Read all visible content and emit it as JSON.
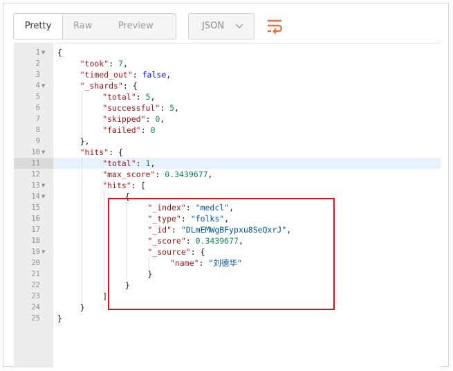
{
  "toolbar": {
    "tabs": [
      {
        "label": "Pretty",
        "active": true
      },
      {
        "label": "Raw",
        "active": false
      },
      {
        "label": "Preview",
        "active": false
      }
    ],
    "format": {
      "label": "JSON",
      "icon": "chevron-down-icon"
    },
    "wrap_icon": "wrap-lines-icon",
    "accent_color": "#f26b3a"
  },
  "editor": {
    "active_line": 11,
    "lines": [
      {
        "num": "1",
        "fold": true,
        "indent": 0,
        "tokens": [
          {
            "t": "p",
            "v": "{"
          }
        ]
      },
      {
        "num": "2",
        "fold": false,
        "indent": 1,
        "tokens": [
          {
            "t": "k",
            "v": "\"took\""
          },
          {
            "t": "p",
            "v": ": "
          },
          {
            "t": "n",
            "v": "7"
          },
          {
            "t": "p",
            "v": ","
          }
        ]
      },
      {
        "num": "3",
        "fold": false,
        "indent": 1,
        "tokens": [
          {
            "t": "k",
            "v": "\"timed_out\""
          },
          {
            "t": "p",
            "v": ": "
          },
          {
            "t": "b",
            "v": "false"
          },
          {
            "t": "p",
            "v": ","
          }
        ]
      },
      {
        "num": "4",
        "fold": true,
        "indent": 1,
        "tokens": [
          {
            "t": "k",
            "v": "\"_shards\""
          },
          {
            "t": "p",
            "v": ": {"
          }
        ]
      },
      {
        "num": "5",
        "fold": false,
        "indent": 2,
        "tokens": [
          {
            "t": "k",
            "v": "\"total\""
          },
          {
            "t": "p",
            "v": ": "
          },
          {
            "t": "n",
            "v": "5"
          },
          {
            "t": "p",
            "v": ","
          }
        ]
      },
      {
        "num": "6",
        "fold": false,
        "indent": 2,
        "tokens": [
          {
            "t": "k",
            "v": "\"successful\""
          },
          {
            "t": "p",
            "v": ": "
          },
          {
            "t": "n",
            "v": "5"
          },
          {
            "t": "p",
            "v": ","
          }
        ]
      },
      {
        "num": "7",
        "fold": false,
        "indent": 2,
        "tokens": [
          {
            "t": "k",
            "v": "\"skipped\""
          },
          {
            "t": "p",
            "v": ": "
          },
          {
            "t": "n",
            "v": "0"
          },
          {
            "t": "p",
            "v": ","
          }
        ]
      },
      {
        "num": "8",
        "fold": false,
        "indent": 2,
        "tokens": [
          {
            "t": "k",
            "v": "\"failed\""
          },
          {
            "t": "p",
            "v": ": "
          },
          {
            "t": "n",
            "v": "0"
          }
        ]
      },
      {
        "num": "9",
        "fold": false,
        "indent": 1,
        "tokens": [
          {
            "t": "p",
            "v": "},"
          }
        ]
      },
      {
        "num": "10",
        "fold": true,
        "indent": 1,
        "tokens": [
          {
            "t": "k",
            "v": "\"hits\""
          },
          {
            "t": "p",
            "v": ": {"
          }
        ]
      },
      {
        "num": "11",
        "fold": false,
        "indent": 2,
        "tokens": [
          {
            "t": "k",
            "v": "\"total\""
          },
          {
            "t": "p",
            "v": ": "
          },
          {
            "t": "n",
            "v": "1"
          },
          {
            "t": "p",
            "v": ","
          }
        ]
      },
      {
        "num": "12",
        "fold": false,
        "indent": 2,
        "tokens": [
          {
            "t": "k",
            "v": "\"max_score\""
          },
          {
            "t": "p",
            "v": ": "
          },
          {
            "t": "n",
            "v": "0.3439677"
          },
          {
            "t": "p",
            "v": ","
          }
        ]
      },
      {
        "num": "13",
        "fold": true,
        "indent": 2,
        "tokens": [
          {
            "t": "k",
            "v": "\"hits\""
          },
          {
            "t": "p",
            "v": ": ["
          }
        ]
      },
      {
        "num": "14",
        "fold": true,
        "indent": 3,
        "tokens": [
          {
            "t": "p",
            "v": "{"
          }
        ]
      },
      {
        "num": "15",
        "fold": false,
        "indent": 4,
        "tokens": [
          {
            "t": "k",
            "v": "\"_index\""
          },
          {
            "t": "p",
            "v": ": "
          },
          {
            "t": "s",
            "v": "\"medcl\""
          },
          {
            "t": "p",
            "v": ","
          }
        ]
      },
      {
        "num": "16",
        "fold": false,
        "indent": 4,
        "tokens": [
          {
            "t": "k",
            "v": "\"_type\""
          },
          {
            "t": "p",
            "v": ": "
          },
          {
            "t": "s",
            "v": "\"folks\""
          },
          {
            "t": "p",
            "v": ","
          }
        ]
      },
      {
        "num": "17",
        "fold": false,
        "indent": 4,
        "tokens": [
          {
            "t": "k",
            "v": "\"_id\""
          },
          {
            "t": "p",
            "v": ": "
          },
          {
            "t": "s",
            "v": "\"DLmEMWgBFypxu8SeQxrJ\""
          },
          {
            "t": "p",
            "v": ","
          }
        ]
      },
      {
        "num": "18",
        "fold": false,
        "indent": 4,
        "tokens": [
          {
            "t": "k",
            "v": "\"_score\""
          },
          {
            "t": "p",
            "v": ": "
          },
          {
            "t": "n",
            "v": "0.3439677"
          },
          {
            "t": "p",
            "v": ","
          }
        ]
      },
      {
        "num": "19",
        "fold": true,
        "indent": 4,
        "tokens": [
          {
            "t": "k",
            "v": "\"_source\""
          },
          {
            "t": "p",
            "v": ": {"
          }
        ]
      },
      {
        "num": "20",
        "fold": false,
        "indent": 5,
        "tokens": [
          {
            "t": "k",
            "v": "\"name\""
          },
          {
            "t": "p",
            "v": ": "
          },
          {
            "t": "s",
            "v": "\"刘德华\""
          }
        ]
      },
      {
        "num": "21",
        "fold": false,
        "indent": 4,
        "tokens": [
          {
            "t": "p",
            "v": "}"
          }
        ]
      },
      {
        "num": "22",
        "fold": false,
        "indent": 3,
        "tokens": [
          {
            "t": "p",
            "v": "}"
          }
        ]
      },
      {
        "num": "23",
        "fold": false,
        "indent": 2,
        "tokens": [
          {
            "t": "p",
            "v": "]"
          }
        ]
      },
      {
        "num": "24",
        "fold": false,
        "indent": 1,
        "tokens": [
          {
            "t": "p",
            "v": "}"
          }
        ]
      },
      {
        "num": "25",
        "fold": false,
        "indent": 0,
        "tokens": [
          {
            "t": "p",
            "v": "}"
          }
        ]
      }
    ]
  }
}
